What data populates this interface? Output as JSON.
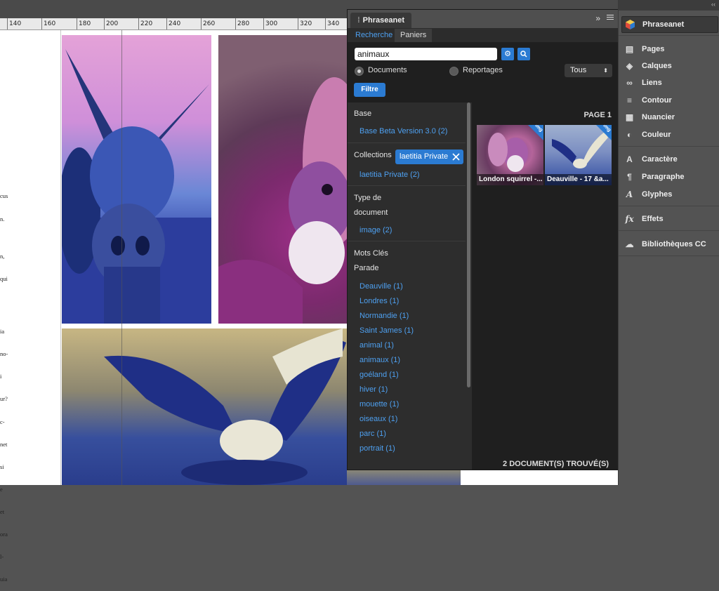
{
  "ruler": {
    "ticks": [
      "140",
      "160",
      "180",
      "200",
      "220",
      "240",
      "260",
      "280",
      "300",
      "320",
      "340"
    ]
  },
  "page_text": [
    "cus",
    "n.",
    "",
    "n,",
    "qui",
    "",
    "",
    "ia",
    "no-",
    "i",
    "ur?",
    "c-",
    "net",
    "si",
    "e",
    "et",
    "ora",
    "l-",
    "uia"
  ],
  "panel": {
    "title": "Phraseanet",
    "header_icons": {
      "expand": "double-chevron-icon",
      "menu": "hamburger-icon"
    },
    "tabs": [
      {
        "label": "Recherche",
        "active": true
      },
      {
        "label": "Paniers",
        "active": false
      }
    ],
    "search": {
      "value": "animaux"
    },
    "radios": [
      {
        "label": "Documents",
        "selected": true
      },
      {
        "label": "Reportages",
        "selected": false
      }
    ],
    "sort": {
      "selected": "Tous"
    },
    "filter_button": "Filtre",
    "facets": {
      "base_label": "Base",
      "base_value": "Base Beta Version 3.0 (2)",
      "collections_label": "Collections",
      "collection_tag": "laetitia Private",
      "collection_value": "laetitia Private (2)",
      "doctype_label_line1": "Type de",
      "doctype_label_line2": "document",
      "doctype_value": "image (2)",
      "keywords_label": "Mots Clés",
      "parade_label": "Parade",
      "keywords": [
        "Deauville (1)",
        "Londres (1)",
        "Normandie (1)",
        "Saint James (1)",
        "animal (1)",
        "animaux (1)",
        "goéland (1)",
        "hiver (1)",
        "mouette (1)",
        "oiseaux (1)",
        "parc (1)",
        "portrait (1)"
      ]
    },
    "page_label": "PAGE 1",
    "results": [
      {
        "caption": "London squirrel -...",
        "badge": "img"
      },
      {
        "caption": "Deauville - 17 &a...",
        "badge": "img"
      }
    ],
    "found": "2 DOCUMENT(S) TROUVÉ(S)"
  },
  "dock": {
    "items": [
      {
        "label": "Phraseanet",
        "icon": "phraseanet-cube-icon"
      },
      {
        "label": "Pages",
        "icon": "pages-icon"
      },
      {
        "label": "Calques",
        "icon": "layers-icon"
      },
      {
        "label": "Liens",
        "icon": "links-icon"
      },
      {
        "label": "Contour",
        "icon": "stroke-icon"
      },
      {
        "label": "Nuancier",
        "icon": "swatches-icon"
      },
      {
        "label": "Couleur",
        "icon": "color-palette-icon"
      },
      {
        "label": "Caractère",
        "icon": "character-icon"
      },
      {
        "label": "Paragraphe",
        "icon": "paragraph-icon"
      },
      {
        "label": "Glyphes",
        "icon": "glyphs-icon"
      },
      {
        "label": "Effets",
        "icon": "fx-icon"
      },
      {
        "label": "Bibliothèques CC",
        "icon": "cc-libraries-icon"
      }
    ]
  },
  "colors": {
    "accent": "#2b7bd2",
    "link": "#4ea0f0"
  }
}
